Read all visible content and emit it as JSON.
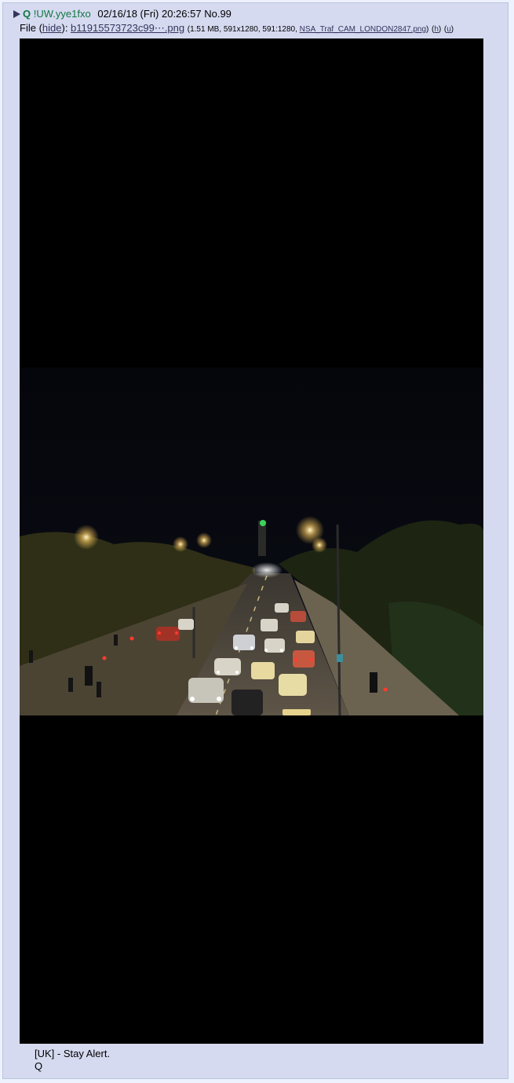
{
  "post": {
    "name": "Q",
    "tripcode": "!UW.yye1fxo",
    "date": "02/16/18 (Fri) 20:26:57",
    "number": "No.99",
    "arrow_icon": "triangle-right-icon"
  },
  "file": {
    "prefix": "File",
    "hide_label": "hide",
    "filename": "b11915573723c99⋯.png",
    "size": "1.51 MB",
    "dimensions": "591x1280",
    "ratio": "591:1280",
    "original_name": "NSA_Traf_CAM_LONDON2847.png",
    "h_label": "h",
    "u_label": "u"
  },
  "message": {
    "line1": "[UK] - Stay Alert.",
    "line2": "Q"
  },
  "colors": {
    "page_bg": "#eef2ff",
    "post_bg": "#d6daf0",
    "name": "#117743",
    "link": "#34345c"
  }
}
